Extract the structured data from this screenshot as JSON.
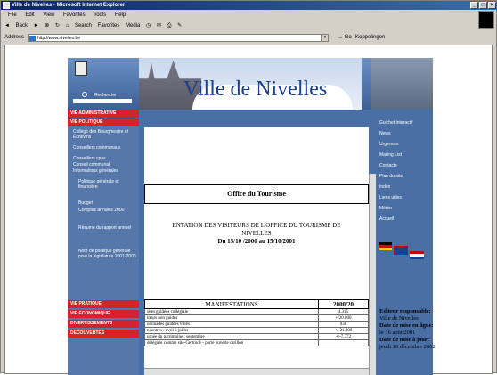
{
  "window": {
    "title": "Ville de Nivelles - Microsoft Internet Explorer"
  },
  "menu": [
    "File",
    "Edit",
    "View",
    "Favorites",
    "Tools",
    "Help"
  ],
  "toolbar": [
    "Back",
    "Search",
    "Favorites",
    "Media"
  ],
  "address": {
    "label": "Address",
    "url": "http://www.nivelles.be",
    "go": "Go",
    "links": "Koppelingen"
  },
  "site": {
    "title": "Ville de Nivelles",
    "search_label": "Recherche",
    "left_nav": {
      "vie_administrative": "VIE ADMINISTRATIVE",
      "vie_politique": "VIE POLITIQUE",
      "sub": [
        "Collège des Bourgmestre et Échevins",
        "Conseillers communaux",
        "Conseillers cpas",
        "Conseil communal",
        "Informations générales",
        "Politique générale et financière",
        "Budget",
        "Comptes annuels 2000",
        "Résumé du rapport annuel",
        "Note de politique générale pour la législature 2001-2006"
      ],
      "vie_pratique": "VIE PRATIQUE",
      "vie_economique": "VIE ECONOMIQUE",
      "divertissements": "DIVERTISSEMENTS",
      "decouvertes": "DECOUVERTES"
    },
    "right_nav": [
      "Guichet interactif",
      "News",
      "Urgences",
      "Mailing List",
      "Contacts",
      "Plan du site",
      "Index",
      "Liens utiles",
      "Météo",
      "Accueil"
    ],
    "office_title": "Office du Tourisme",
    "presentation_line1": "ENTATION DES VISITEURS DE L'OFFICE DU TOURISME DE",
    "presentation_line2": "NIVELLES",
    "presentation_line3": "Du 15/10 /2000 au 15/10/2001",
    "table": {
      "header": "MANIFESTATIONS",
      "header_year": "2000/20",
      "rows": [
        {
          "label": "sites guidées collégiale",
          "value": "4.315"
        },
        {
          "label": "iteurs non guidés",
          "value": "+/20.000"
        },
        {
          "label": "ominades guidées villes",
          "value": "938"
        },
        {
          "label": "ncontres : avril à juillet",
          "value": "+/-21.000"
        },
        {
          "label": "urnée du patrimoine : septembre",
          "value": "+/-7.372"
        },
        {
          "label": "délégués comme site-Gertrude - porte ouverte carillon",
          "value": ""
        }
      ]
    },
    "editor": {
      "label": "Editeur responsable:",
      "name": "Ville de Nivelles",
      "online_label": "Date de mise en ligne:",
      "online_date": "le 16 août 2001",
      "update_label": "Date de mise à jour:",
      "update_date": "jeudi 19 décembre 2002"
    }
  }
}
